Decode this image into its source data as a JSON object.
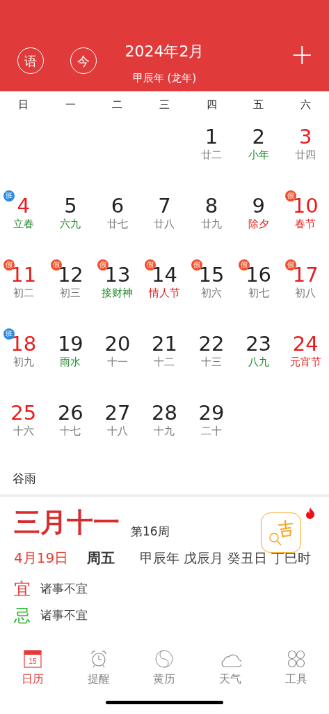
{
  "header": {
    "left_buttons": [
      "语",
      "今"
    ],
    "title": "2024年2月",
    "subtitle": "甲辰年 (龙年)",
    "add": "+"
  },
  "weekdays": [
    "日",
    "一",
    "二",
    "三",
    "四",
    "五",
    "六"
  ],
  "weeks": [
    [
      {
        "day": {
          "text": "1",
          "color": "#222222"
        },
        "lunar": {
          "text": "廿二",
          "color": "#777777"
        }
      },
      {
        "day": {
          "text": "2",
          "color": "#222222"
        },
        "lunar": {
          "text": "小年",
          "color": "#1f8a2a"
        }
      },
      {
        "day": {
          "text": "3",
          "color": "#e81c1c"
        },
        "lunar": {
          "text": "廿四",
          "color": "#777777"
        }
      }
    ],
    [
      {
        "day": {
          "text": "4",
          "color": "#e81c1c"
        },
        "lunar": {
          "text": "立春",
          "color": "#1f8a2a"
        },
        "badge": {
          "text": "班",
          "color": "#2b8be0"
        }
      },
      {
        "day": {
          "text": "5",
          "color": "#222222"
        },
        "lunar": {
          "text": "六九",
          "color": "#1f8a2a"
        }
      },
      {
        "day": {
          "text": "6",
          "color": "#222222"
        },
        "lunar": {
          "text": "廿七",
          "color": "#777777"
        }
      },
      {
        "day": {
          "text": "7",
          "color": "#222222"
        },
        "lunar": {
          "text": "廿八",
          "color": "#777777"
        }
      },
      {
        "day": {
          "text": "8",
          "color": "#222222"
        },
        "lunar": {
          "text": "廿九",
          "color": "#777777"
        }
      },
      {
        "day": {
          "text": "9",
          "color": "#222222"
        },
        "lunar": {
          "text": "除夕",
          "color": "#e81c1c"
        }
      },
      {
        "day": {
          "text": "10",
          "color": "#e81c1c"
        },
        "lunar": {
          "text": "春节",
          "color": "#e81c1c"
        },
        "badge": {
          "text": "假",
          "color": "#f0522e"
        }
      }
    ],
    [
      {
        "day": {
          "text": "11",
          "color": "#e81c1c"
        },
        "lunar": {
          "text": "初二",
          "color": "#777777"
        },
        "badge": {
          "text": "假",
          "color": "#f0522e"
        }
      },
      {
        "day": {
          "text": "12",
          "color": "#222222"
        },
        "lunar": {
          "text": "初三",
          "color": "#777777"
        },
        "badge": {
          "text": "假",
          "color": "#f0522e"
        }
      },
      {
        "day": {
          "text": "13",
          "color": "#222222"
        },
        "lunar": {
          "text": "接财神",
          "color": "#1f8a2a"
        },
        "badge": {
          "text": "假",
          "color": "#f0522e"
        }
      },
      {
        "day": {
          "text": "14",
          "color": "#222222"
        },
        "lunar": {
          "text": "情人节",
          "color": "#e81c1c"
        },
        "badge": {
          "text": "假",
          "color": "#f0522e"
        }
      },
      {
        "day": {
          "text": "15",
          "color": "#222222"
        },
        "lunar": {
          "text": "初六",
          "color": "#777777"
        },
        "badge": {
          "text": "假",
          "color": "#f0522e"
        }
      },
      {
        "day": {
          "text": "16",
          "color": "#222222"
        },
        "lunar": {
          "text": "初七",
          "color": "#777777"
        },
        "badge": {
          "text": "假",
          "color": "#f0522e"
        }
      },
      {
        "day": {
          "text": "17",
          "color": "#e81c1c"
        },
        "lunar": {
          "text": "初八",
          "color": "#777777"
        },
        "badge": {
          "text": "假",
          "color": "#f0522e"
        }
      }
    ],
    [
      {
        "day": {
          "text": "18",
          "color": "#e81c1c"
        },
        "lunar": {
          "text": "初九",
          "color": "#777777"
        },
        "badge": {
          "text": "班",
          "color": "#2b8be0"
        }
      },
      {
        "day": {
          "text": "19",
          "color": "#222222"
        },
        "lunar": {
          "text": "雨水",
          "color": "#1f8a2a"
        }
      },
      {
        "day": {
          "text": "20",
          "color": "#222222"
        },
        "lunar": {
          "text": "十一",
          "color": "#777777"
        }
      },
      {
        "day": {
          "text": "21",
          "color": "#222222"
        },
        "lunar": {
          "text": "十二",
          "color": "#777777"
        }
      },
      {
        "day": {
          "text": "22",
          "color": "#222222"
        },
        "lunar": {
          "text": "十三",
          "color": "#777777"
        }
      },
      {
        "day": {
          "text": "23",
          "color": "#222222"
        },
        "lunar": {
          "text": "八九",
          "color": "#1f8a2a"
        }
      },
      {
        "day": {
          "text": "24",
          "color": "#e81c1c"
        },
        "lunar": {
          "text": "元宵节",
          "color": "#e81c1c"
        }
      }
    ],
    [
      {
        "day": {
          "text": "25",
          "color": "#e81c1c"
        },
        "lunar": {
          "text": "十六",
          "color": "#777777"
        }
      },
      {
        "day": {
          "text": "26",
          "color": "#222222"
        },
        "lunar": {
          "text": "十七",
          "color": "#777777"
        }
      },
      {
        "day": {
          "text": "27",
          "color": "#222222"
        },
        "lunar": {
          "text": "十八",
          "color": "#777777"
        }
      },
      {
        "day": {
          "text": "28",
          "color": "#222222"
        },
        "lunar": {
          "text": "十九",
          "color": "#777777"
        }
      },
      {
        "day": {
          "text": "29",
          "color": "#222222"
        },
        "lunar": {
          "text": "二十",
          "color": "#777777"
        }
      }
    ]
  ],
  "solar_term_note": "谷雨",
  "detail": {
    "lunar_date": "三月十一",
    "week_number": "第16周",
    "date": "4月19日",
    "weekday": "周五",
    "ganzhi": "甲辰年 戊辰月 癸丑日 丁巳时",
    "rows": [
      {
        "color": "#e53935",
        "label": "宜",
        "text": "诸事不宜"
      },
      {
        "color": "#2fb52f",
        "label": "忌",
        "text": "诸事不宜"
      }
    ]
  },
  "tabs": [
    {
      "label": "日历",
      "selected": true,
      "icon_text": "15"
    },
    {
      "label": "提醒",
      "selected": false
    },
    {
      "label": "黄历",
      "selected": false
    },
    {
      "label": "天气",
      "selected": false
    },
    {
      "label": "工具",
      "selected": false
    }
  ]
}
